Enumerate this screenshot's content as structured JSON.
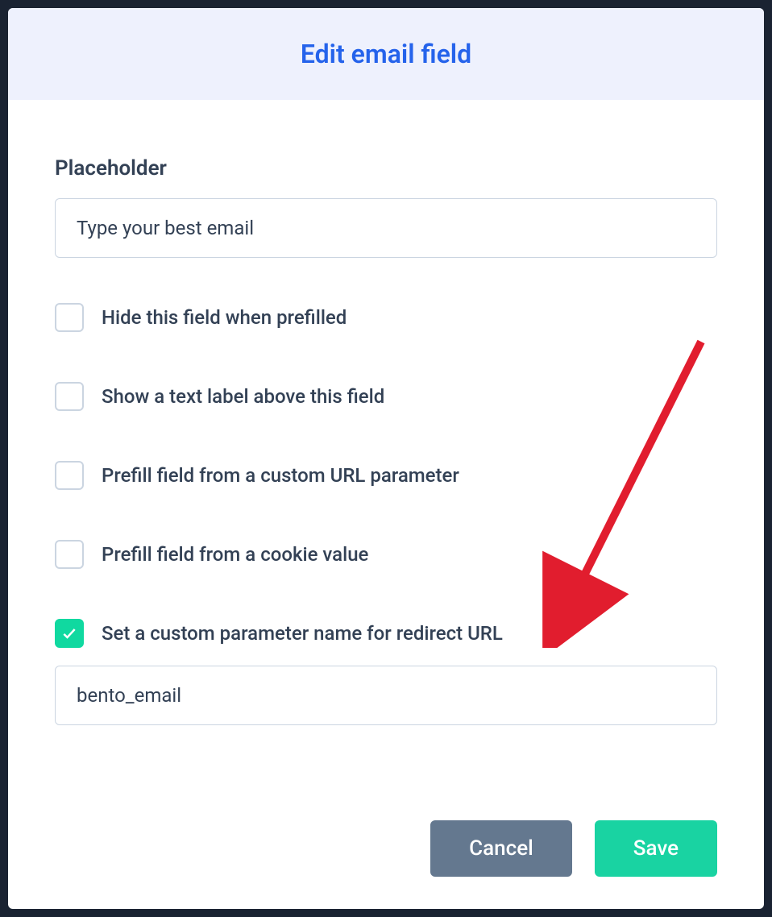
{
  "modal": {
    "title": "Edit email field"
  },
  "placeholder": {
    "label": "Placeholder",
    "value": "Type your best email"
  },
  "options": {
    "hide_when_prefilled": {
      "label": "Hide this field when prefilled",
      "checked": false
    },
    "show_text_label": {
      "label": "Show a text label above this field",
      "checked": false
    },
    "prefill_url_param": {
      "label": "Prefill field from a custom URL parameter",
      "checked": false
    },
    "prefill_cookie": {
      "label": "Prefill field from a cookie value",
      "checked": false
    },
    "custom_redirect_param": {
      "label": "Set a custom parameter name for redirect URL",
      "checked": true,
      "value": "bento_email"
    }
  },
  "actions": {
    "cancel": "Cancel",
    "save": "Save"
  }
}
